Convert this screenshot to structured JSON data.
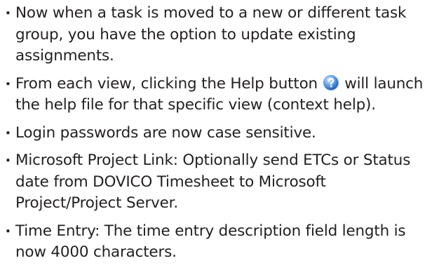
{
  "features": [
    {
      "lines": [
        "Now when a task is moved to a new or different task",
        "group, you have the option to update existing",
        "assignments."
      ]
    },
    {
      "line1_before_icon": "From each view, clicking the Help button ",
      "line1_after_icon": " will launch",
      "icon": "help-icon",
      "lines": [
        "the help file for that specific view (context help)."
      ]
    },
    {
      "lines": [
        "Login passwords are now case sensitive."
      ]
    },
    {
      "lines": [
        "Microsoft Project Link: Optionally send ETCs or Status",
        "date from DOVICO Timesheet to Microsoft",
        "Project/Project Server."
      ]
    },
    {
      "lines": [
        "Time Entry: The time entry description field length is",
        "now 4000 characters."
      ]
    }
  ],
  "bullet_glyph": "•"
}
